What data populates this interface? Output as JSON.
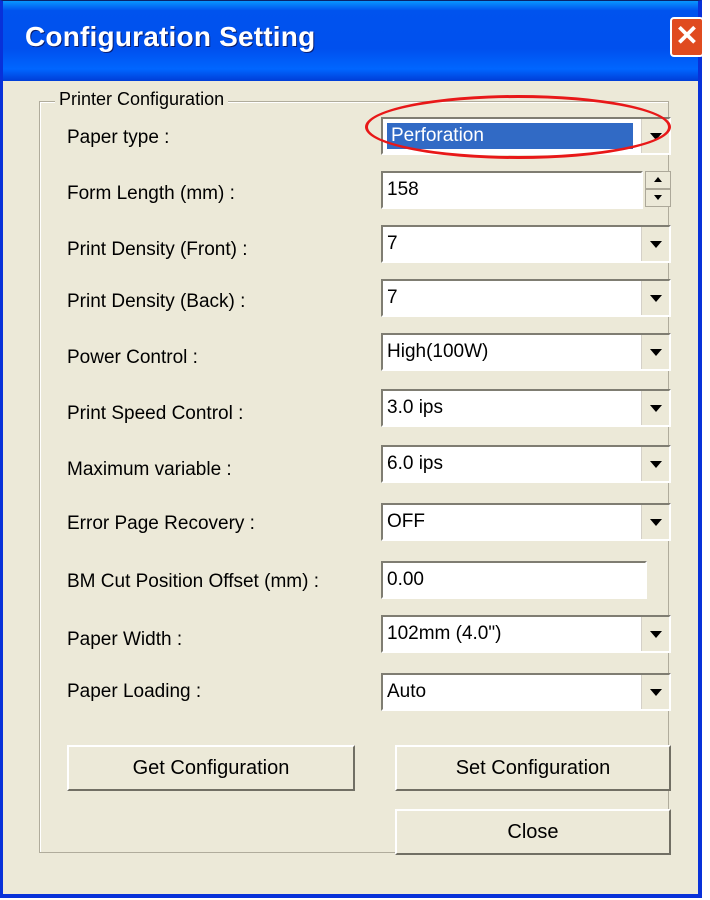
{
  "window": {
    "title": "Configuration Setting",
    "close_icon": "close-icon",
    "accent": "#0053ee"
  },
  "group": {
    "label": "Printer Configuration"
  },
  "fields": {
    "paper_type": {
      "label": "Paper type :",
      "value": "Perforation"
    },
    "form_length": {
      "label": "Form Length (mm) :",
      "value": "158"
    },
    "density_front": {
      "label": "Print Density (Front) :",
      "value": "7"
    },
    "density_back": {
      "label": "Print Density (Back) :",
      "value": "7"
    },
    "power_control": {
      "label": "Power Control :",
      "value": "High(100W)"
    },
    "speed_control": {
      "label": "Print Speed Control :",
      "value": "3.0 ips"
    },
    "max_variable": {
      "label": "Maximum variable :",
      "value": "6.0 ips"
    },
    "error_recovery": {
      "label": "Error Page Recovery :",
      "value": "OFF"
    },
    "bm_offset": {
      "label": "BM Cut Position Offset (mm) :",
      "value": "0.00"
    },
    "paper_width": {
      "label": "Paper Width :",
      "value": "102mm (4.0\")"
    },
    "paper_loading": {
      "label": "Paper Loading :",
      "value": "Auto"
    }
  },
  "buttons": {
    "get": "Get Configuration",
    "set": "Set Configuration",
    "close": "Close"
  },
  "annotation_color": "#e81818"
}
